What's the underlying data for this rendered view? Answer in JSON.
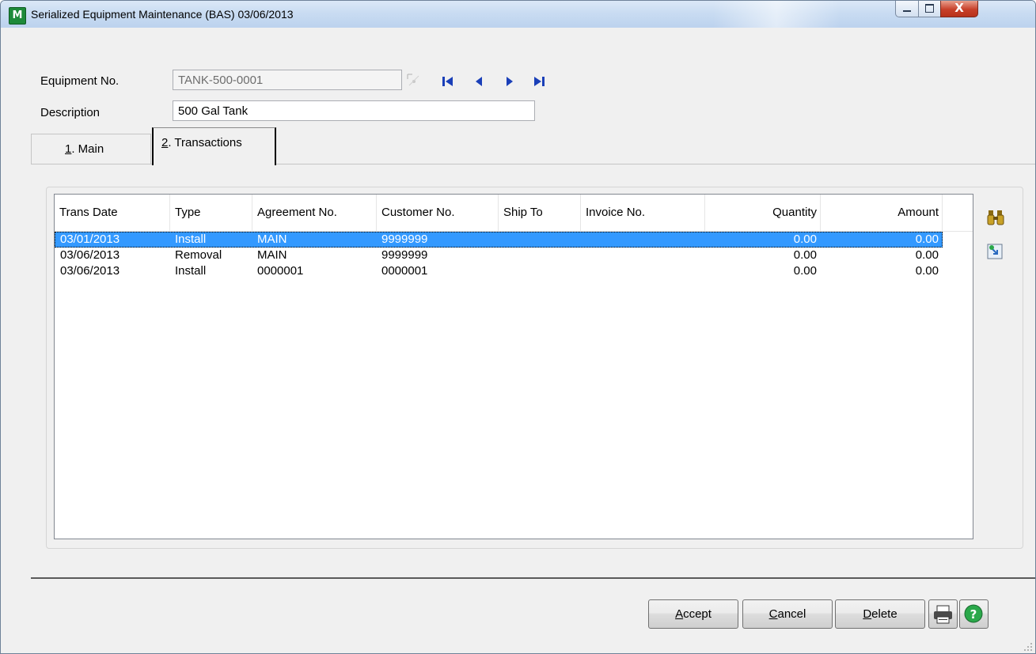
{
  "window": {
    "title": "Serialized Equipment Maintenance (BAS) 03/06/2013",
    "close_glyph": "X",
    "app_icon": "M"
  },
  "header": {
    "equipment_label": "Equipment No.",
    "equipment_value": "TANK-500-0001",
    "description_label": "Description",
    "description_value": "500 Gal Tank"
  },
  "tabs": [
    {
      "label": "1. Main",
      "mnemonic": "1",
      "rest": ". Main"
    },
    {
      "label": "2. Transactions",
      "mnemonic": "2",
      "rest": ". Transactions"
    }
  ],
  "grid": {
    "columns": [
      "Trans Date",
      "Type",
      "Agreement No.",
      "Customer No.",
      "Ship To",
      "Invoice No.",
      "Quantity",
      "Amount"
    ],
    "rows": [
      {
        "trans_date": "03/01/2013",
        "type": "Install",
        "agreement_no": "MAIN",
        "customer_no": "9999999",
        "ship_to": "",
        "invoice_no": "",
        "quantity": "0.00",
        "amount": "0.00",
        "selected": true
      },
      {
        "trans_date": "03/06/2013",
        "type": "Removal",
        "agreement_no": "MAIN",
        "customer_no": "9999999",
        "ship_to": "",
        "invoice_no": "",
        "quantity": "0.00",
        "amount": "0.00",
        "selected": false
      },
      {
        "trans_date": "03/06/2013",
        "type": "Install",
        "agreement_no": "0000001",
        "customer_no": "0000001",
        "ship_to": "",
        "invoice_no": "",
        "quantity": "0.00",
        "amount": "0.00",
        "selected": false
      }
    ]
  },
  "buttons": {
    "accept": {
      "mnemonic": "A",
      "rest": "ccept"
    },
    "cancel": {
      "mnemonic": "C",
      "rest": "ancel"
    },
    "delete": {
      "mnemonic": "D",
      "rest": "elete"
    }
  },
  "icons": {
    "nav": [
      "first-record-icon",
      "previous-record-icon",
      "next-record-icon",
      "last-record-icon"
    ],
    "side": [
      "binoculars-icon",
      "drilldown-icon"
    ],
    "footer": [
      "printer-icon",
      "help-icon"
    ]
  },
  "colors": {
    "selection": "#3399ff",
    "nav_arrow": "#1a3fb8",
    "help": "#2aa84a"
  }
}
